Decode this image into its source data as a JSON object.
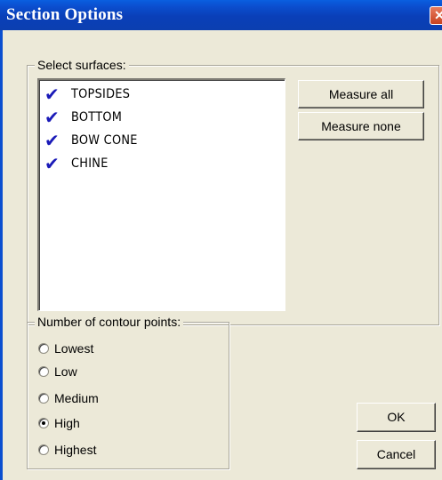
{
  "window": {
    "title": "Section Options",
    "close_glyph": "✕"
  },
  "surfaces": {
    "legend": "Select surfaces:",
    "items": [
      {
        "label": "TOPSIDES",
        "checked": true
      },
      {
        "label": "BOTTOM",
        "checked": true
      },
      {
        "label": "BOW CONE",
        "checked": true
      },
      {
        "label": "CHINE",
        "checked": true
      }
    ],
    "check_glyph": "✔",
    "measure_all_label": "Measure all",
    "measure_none_label": "Measure none"
  },
  "contour": {
    "legend": "Number of contour points:",
    "options": [
      {
        "label": "Lowest",
        "selected": false
      },
      {
        "label": "Low",
        "selected": false
      },
      {
        "label": "Medium",
        "selected": false
      },
      {
        "label": "High",
        "selected": true
      },
      {
        "label": "Highest",
        "selected": false
      }
    ]
  },
  "buttons": {
    "ok_label": "OK",
    "cancel_label": "Cancel"
  },
  "colors": {
    "titlebar": "#0a4fd0",
    "dialog_bg": "#ece9d8",
    "check": "#1a1ab8",
    "close": "#d9542f"
  }
}
